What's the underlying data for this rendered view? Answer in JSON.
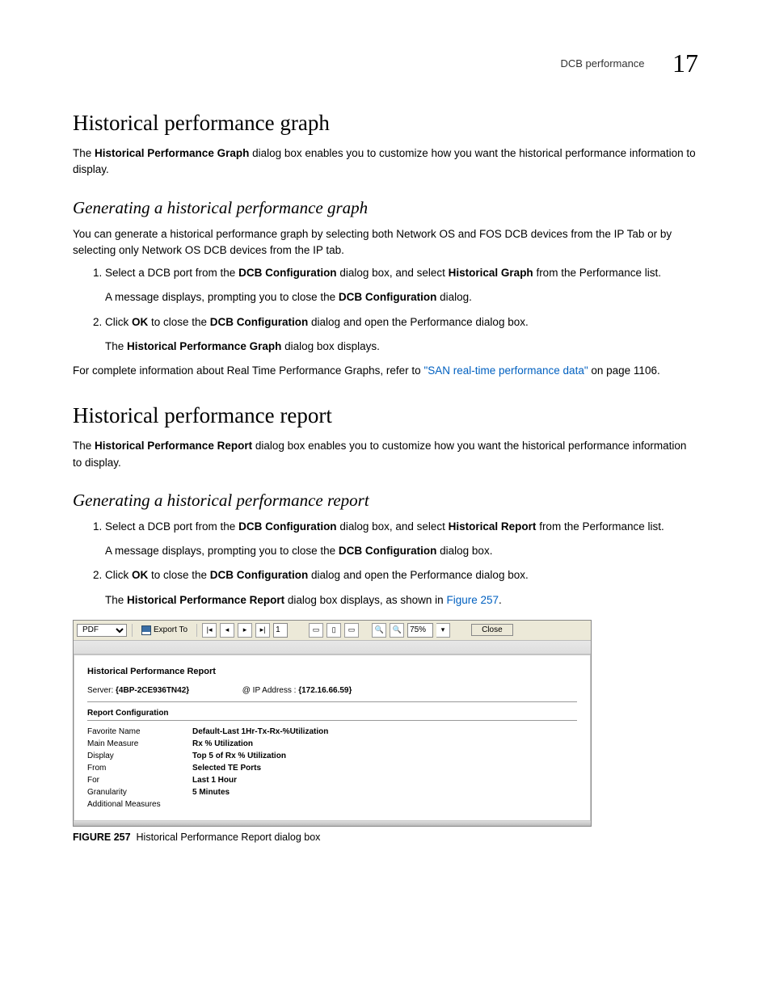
{
  "header": {
    "section_title": "DCB performance",
    "chapter_number": "17"
  },
  "h1_graph": "Historical performance graph",
  "p_graph_intro_pre": "The ",
  "p_graph_intro_b": "Historical Performance Graph",
  "p_graph_intro_post": " dialog box enables you to customize how you want the historical performance information to display.",
  "h2_graph_gen": "Generating a historical performance graph",
  "p_graph_gen_intro": "You can generate a historical performance graph by selecting both Network OS and FOS DCB devices from the IP Tab or by selecting only Network OS DCB devices from the IP tab.",
  "graph_steps": {
    "s1_pre": "Select a DCB port from the ",
    "s1_b1": "DCB Configuration",
    "s1_mid": " dialog box, and select ",
    "s1_b2": "Historical Graph",
    "s1_post": " from the Performance list.",
    "s1_sub_pre": "A message displays, prompting you to close the ",
    "s1_sub_b": "DCB Configuration",
    "s1_sub_post": " dialog.",
    "s2_pre": "Click ",
    "s2_b1": "OK",
    "s2_mid": " to close the ",
    "s2_b2": "DCB Configuration",
    "s2_post": " dialog and open the Performance dialog box.",
    "s2_sub_pre": "The ",
    "s2_sub_b": "Historical Performance Graph",
    "s2_sub_post": " dialog box displays."
  },
  "p_graph_ref_pre": "For complete information about Real Time Performance Graphs, refer to ",
  "p_graph_ref_link": "\"SAN real-time performance data\"",
  "p_graph_ref_post": " on page 1106.",
  "h1_report": "Historical performance report",
  "p_report_intro_pre": "The ",
  "p_report_intro_b": "Historical Performance Report",
  "p_report_intro_post": " dialog box enables you to customize how you want the historical performance information to display.",
  "h2_report_gen": "Generating a historical performance report",
  "report_steps": {
    "s1_pre": "Select a DCB port from the ",
    "s1_b1": "DCB Configuration",
    "s1_mid": " dialog box, and select ",
    "s1_b2": "Historical Report",
    "s1_post": " from the Performance list.",
    "s1_sub_pre": "A message displays, prompting you to close the ",
    "s1_sub_b": "DCB Configuration",
    "s1_sub_post": " dialog box.",
    "s2_pre": "Click ",
    "s2_b1": "OK",
    "s2_mid": " to close the ",
    "s2_b2": "DCB Configuration",
    "s2_post": " dialog and open the Performance dialog box.",
    "s2_sub_pre": "The ",
    "s2_sub_b": "Historical Performance Report",
    "s2_sub_mid": " dialog box displays, as shown in ",
    "s2_sub_link": "Figure 257",
    "s2_sub_post": "."
  },
  "dialog": {
    "format_select": "PDF",
    "export_label": "Export To",
    "page_value": "1",
    "zoom_value": "75%",
    "close_label": "Close",
    "report_title": "Historical Performance Report",
    "server_label": "Server:",
    "server_value": "{4BP-2CE936TN42}",
    "ip_label": "@ IP Address :",
    "ip_value": "{172.16.66.59}",
    "section_title": "Report Configuration",
    "rows": [
      {
        "k": "Favorite Name",
        "v": "Default-Last 1Hr-Tx-Rx-%Utilization"
      },
      {
        "k": "Main Measure",
        "v": "Rx % Utilization"
      },
      {
        "k": "Display",
        "v": "Top 5 of Rx % Utilization"
      },
      {
        "k": "From",
        "v": "Selected TE Ports"
      },
      {
        "k": "For",
        "v": "Last 1 Hour"
      },
      {
        "k": "Granularity",
        "v": "5 Minutes"
      },
      {
        "k": "Additional Measures",
        "v": ""
      }
    ]
  },
  "figure_caption_num": "FIGURE 257",
  "figure_caption_text": "Historical Performance Report dialog box"
}
